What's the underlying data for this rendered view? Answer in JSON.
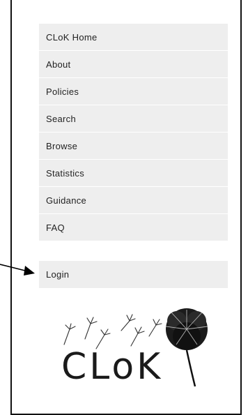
{
  "nav": {
    "items": [
      {
        "label": "CLoK Home"
      },
      {
        "label": "About"
      },
      {
        "label": "Policies"
      },
      {
        "label": "Search"
      },
      {
        "label": "Browse"
      },
      {
        "label": "Statistics"
      },
      {
        "label": "Guidance"
      },
      {
        "label": "FAQ"
      }
    ]
  },
  "login": {
    "label": "Login"
  },
  "logo": {
    "text": "CLoK",
    "icon": "dandelion-logo"
  }
}
